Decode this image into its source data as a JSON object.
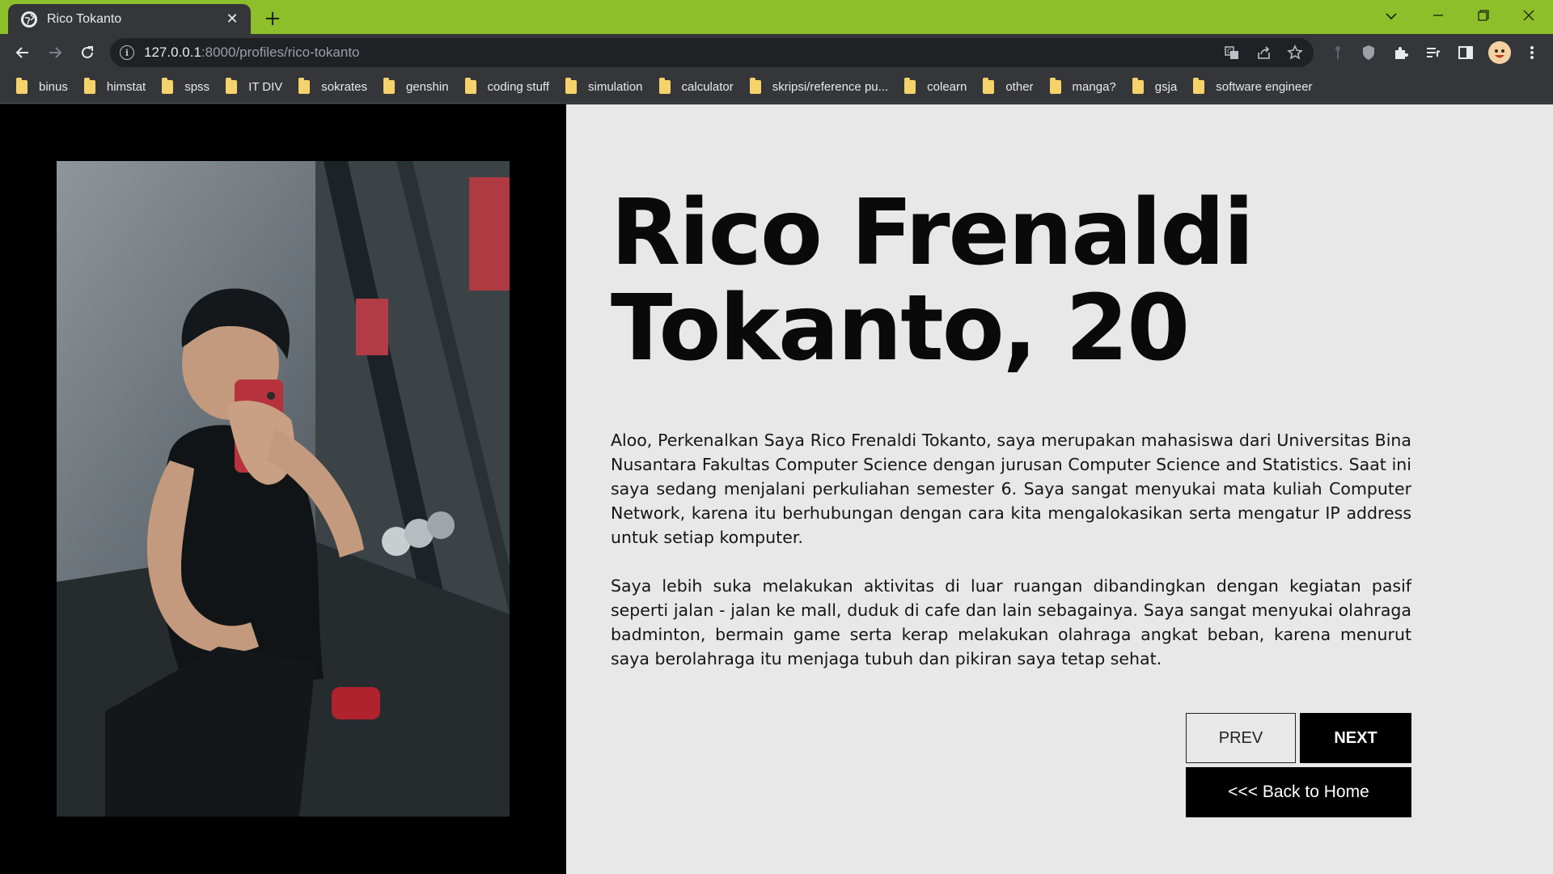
{
  "browser": {
    "tab_title": "Rico Tokanto",
    "url_host": "127.0.0.1",
    "url_rest": ":8000/profiles/rico-tokanto",
    "theme_color": "#8dbf2b"
  },
  "bookmarks": [
    {
      "label": "binus"
    },
    {
      "label": "himstat"
    },
    {
      "label": "spss"
    },
    {
      "label": "IT DIV"
    },
    {
      "label": "sokrates"
    },
    {
      "label": "genshin"
    },
    {
      "label": "coding stuff"
    },
    {
      "label": "simulation"
    },
    {
      "label": "calculator"
    },
    {
      "label": "skripsi/reference pu..."
    },
    {
      "label": "colearn"
    },
    {
      "label": "other"
    },
    {
      "label": "manga?"
    },
    {
      "label": "gsja"
    },
    {
      "label": "software engineer"
    }
  ],
  "profile": {
    "name_line1": "Rico Frenaldi",
    "name_line2": "Tokanto, 20",
    "paragraph1": "Aloo, Perkenalkan Saya Rico Frenaldi Tokanto, saya merupakan mahasiswa dari Universitas Bina Nusantara Fakultas Computer Science dengan jurusan Computer Science and Statistics. Saat ini saya sedang menjalani perkuliahan semester 6. Saya sangat menyukai mata kuliah Computer Network, karena itu berhubungan dengan cara kita mengalokasikan serta mengatur IP address untuk setiap komputer.",
    "paragraph2": "Saya lebih suka melakukan aktivitas di luar ruangan dibandingkan dengan kegiatan pasif seperti jalan - jalan ke mall, duduk di cafe dan lain sebagainya. Saya sangat menyukai olahraga badminton, bermain game serta kerap melakukan olahraga angkat beban, karena menurut saya berolahraga itu menjaga tubuh dan pikiran saya tetap sehat.",
    "prev_label": "PREV",
    "next_label": "NEXT",
    "home_label": "<<< Back to Home"
  }
}
